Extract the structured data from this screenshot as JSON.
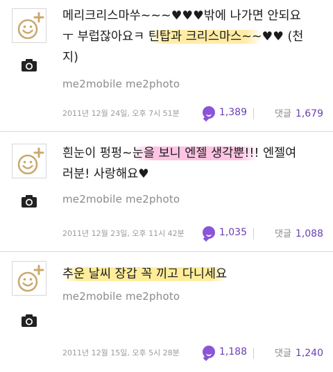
{
  "posts": [
    {
      "text_parts": [
        "메리크리스마쑤~~~♥♥♥밖에 나가면 안되요",
        "ㅜ 부럽잖아요ㅋ ",
        "틴탑과 크리스마스~~",
        "♥♥ (천",
        "지)"
      ],
      "source": "me2mobile me2photo",
      "date": "2011년 12월 24일, 오후 7시 51분",
      "likes": "1,389",
      "comments_label": "댓글",
      "comments": "1,679"
    },
    {
      "text_parts": [
        "흰눈이 펑펑~",
        "눈을 보니 엔젤 생각뿐!!!",
        " 엔젤여",
        "러분! 사랑해요♥"
      ],
      "source": "me2mobile me2photo",
      "date": "2011년 12월 23일, 오후 11시 42분",
      "likes": "1,035",
      "comments_label": "댓글",
      "comments": "1,088"
    },
    {
      "text_parts": [
        "추운 날씨 장갑 꼭 끼고 다니세요"
      ],
      "source": "me2mobile me2photo",
      "date": "2011년 12월 15일, 오후 5시 28분",
      "likes": "1,188",
      "comments_label": "댓글",
      "comments": "1,240"
    }
  ],
  "colors": {
    "accent": "#6a3fb0",
    "avatar_gold": "#c9a96e",
    "highlight_yellow": "#ffe896",
    "highlight_pink": "#ffbee1"
  },
  "icons": {
    "avatar": "smiley-plus-icon",
    "camera": "camera-icon",
    "like": "me2-bubble-icon"
  }
}
